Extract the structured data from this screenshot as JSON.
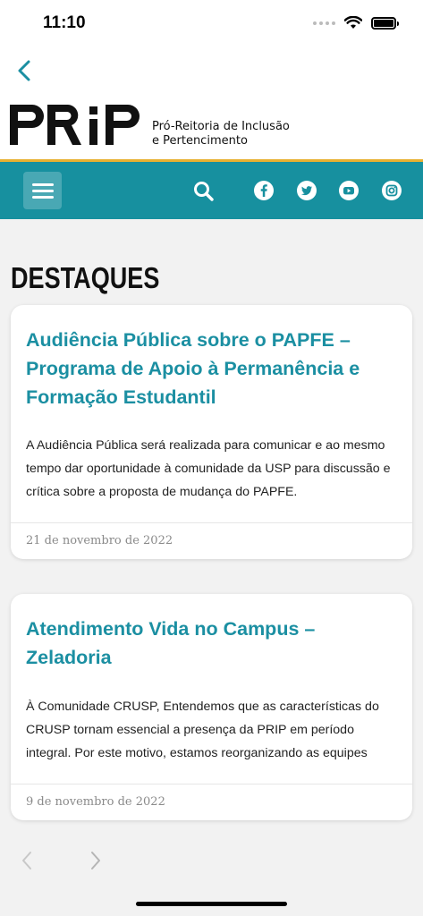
{
  "status_bar": {
    "time": "11:10"
  },
  "header": {
    "logo_text": "PRiP",
    "logo_subtitle_line1": "Pró-Reitoria de Inclusão",
    "logo_subtitle_line2": "e Pertencimento"
  },
  "nav": {
    "icons": [
      "menu-icon",
      "search-icon",
      "facebook-icon",
      "twitter-icon",
      "youtube-icon",
      "instagram-icon"
    ]
  },
  "colors": {
    "teal": "#17909f",
    "accent_rule": "#e8b031",
    "title_text": "#1b8fa2"
  },
  "section_title": "DESTAQUES",
  "cards": [
    {
      "title_lines": [
        "Audiência Pública sobre o PAPFE –",
        "Programa de Apoio à Permanência e",
        "Formação Estudantil"
      ],
      "text_lines": [
        "A Audiência Pública será realizada para comunicar e ao mesmo",
        "tempo dar oportunidade à comunidade da USP para discussão e",
        "crítica sobre a proposta de mudança do PAPFE."
      ],
      "date": "21 de novembro de 2022"
    },
    {
      "title_lines": [
        "Atendimento Vida no Campus –",
        "Zeladoria"
      ],
      "text_lines": [
        "À Comunidade CRUSP, Entendemos que as características do",
        "CRUSP tornam essencial a presença da PRIP em período",
        "integral. Por este motivo, estamos reorganizando as equipes"
      ],
      "date": "9 de novembro de 2022"
    }
  ]
}
